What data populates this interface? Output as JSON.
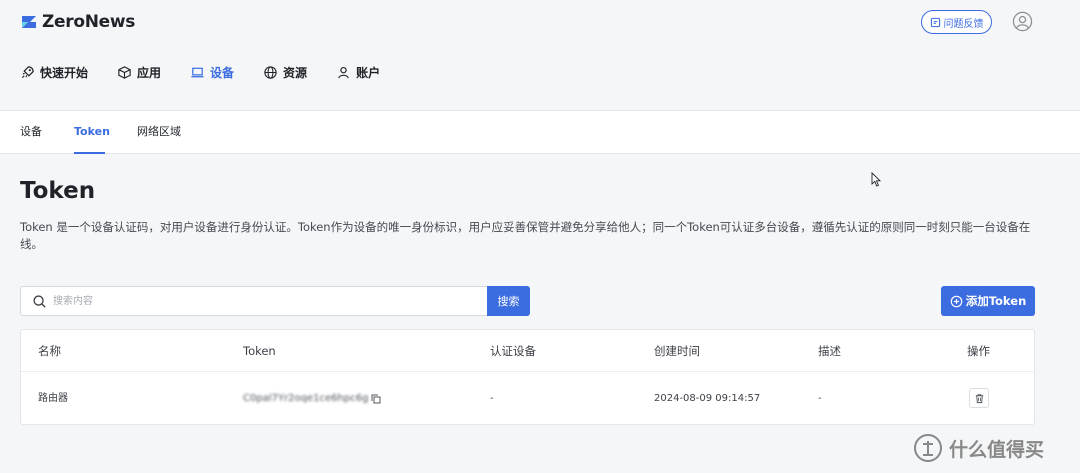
{
  "brand": {
    "name": "ZeroNews",
    "color": "#3b6ce0"
  },
  "header": {
    "feedback_label": "问题反馈",
    "user_icon": "user-circle-icon"
  },
  "main_nav": [
    {
      "label": "快速开始",
      "icon": "rocket-icon",
      "active": false
    },
    {
      "label": "应用",
      "icon": "cube-icon",
      "active": false
    },
    {
      "label": "设备",
      "icon": "laptop-icon",
      "active": true
    },
    {
      "label": "资源",
      "icon": "globe-icon",
      "active": false
    },
    {
      "label": "账户",
      "icon": "user-icon",
      "active": false
    }
  ],
  "sub_nav": [
    {
      "label": "设备",
      "active": false
    },
    {
      "label": "Token",
      "active": true
    },
    {
      "label": "网络区域",
      "active": false
    }
  ],
  "page": {
    "title": "Token",
    "description": "Token 是一个设备认证码，对用户设备进行身份认证。Token作为设备的唯一身份标识，用户应妥善保管并避免分享给他人；同一个Token可认证多台设备，遵循先认证的原则同一时刻只能一台设备在线。"
  },
  "search": {
    "placeholder": "搜索内容",
    "value": "",
    "button_label": "搜索"
  },
  "add_button_label": "添加Token",
  "table": {
    "columns": [
      "名称",
      "Token",
      "认证设备",
      "创建时间",
      "描述",
      "操作"
    ],
    "rows": [
      {
        "name": "路由器",
        "token": "C0pal7Yr2oqe1ce6hpc6g",
        "device": "-",
        "created": "2024-08-09 09:14:57",
        "description": "-",
        "action_icon": "trash-icon"
      }
    ]
  },
  "watermark": {
    "text": "什么值得买"
  }
}
